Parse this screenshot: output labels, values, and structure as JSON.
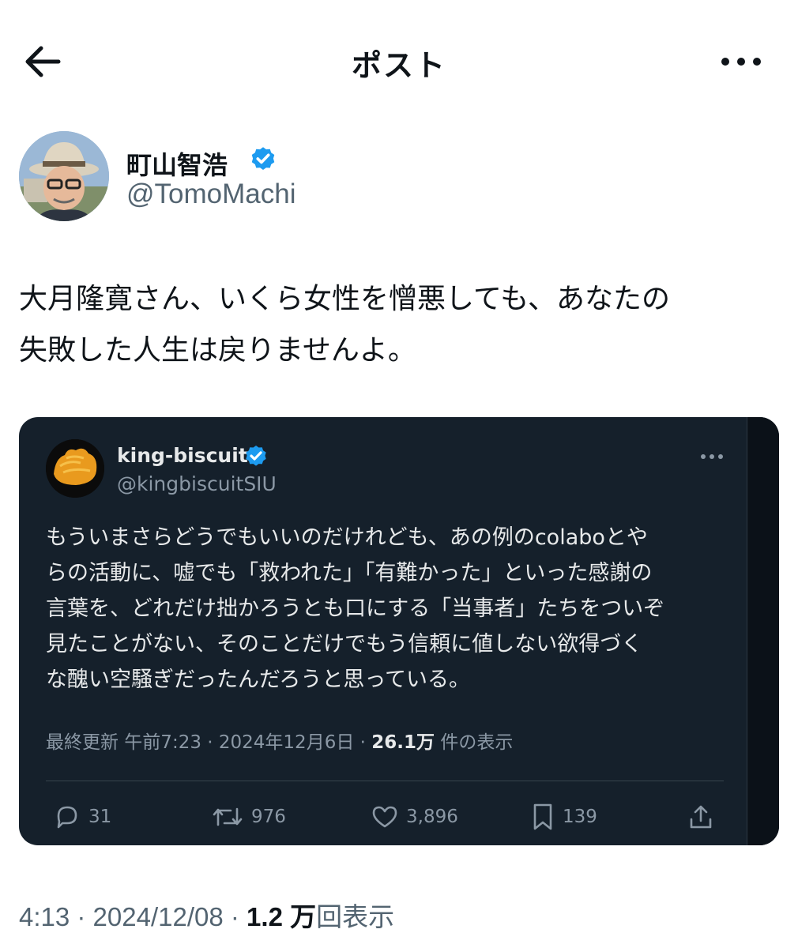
{
  "header": {
    "title": "ポスト"
  },
  "author": {
    "name": "町山智浩",
    "handle": "@TomoMachi"
  },
  "post": {
    "text_line1": "大月隆寛さん、いくら女性を憎悪しても、あなたの",
    "text_line2": "失敗した人生は戻りませんよ。"
  },
  "quote": {
    "name": "king-biscuit",
    "handle": "@kingbiscuitSIU",
    "lines": [
      "もういまさらどうでもいいのだけれども、あの例のcolaboとや",
      "らの活動に、嘘でも「救われた」「有難かった」といった感謝の",
      "言葉を、どれだけ拙かろうとも口にする「当事者」たちをついぞ",
      "見たことがない、そのことだけでもう信頼に値しない欲得づく",
      "な醜い空騒ぎだったんだろうと思っている。"
    ],
    "meta_prefix": "最終更新 午前7:23 · 2024年12月6日 · ",
    "views_count": "26.1万",
    "views_label": " 件の表示",
    "replies": "31",
    "reposts": "976",
    "likes": "3,896",
    "bookmarks": "139"
  },
  "footer": {
    "time_date": "4:13 · 2024/12/08 · ",
    "views_count": "1.2 万",
    "views_label": "回表示"
  },
  "colors": {
    "verified": "#1d9bf0",
    "quote_bg": "#15202b",
    "secondary_text": "#536471"
  },
  "icons": [
    "back-arrow-icon",
    "more-icon",
    "verified-badge-icon",
    "reply-icon",
    "repost-icon",
    "like-icon",
    "bookmark-icon",
    "share-icon"
  ]
}
